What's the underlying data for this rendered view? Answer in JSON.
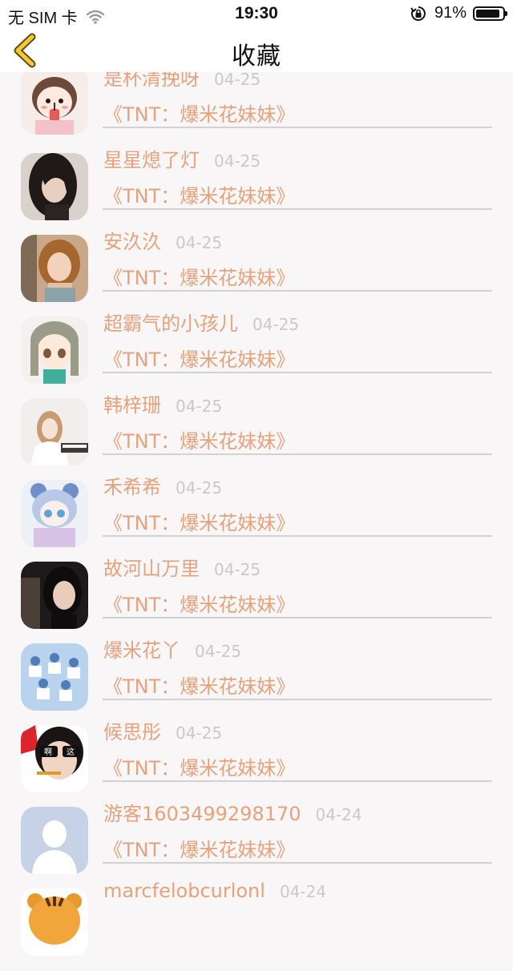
{
  "status_bar": {
    "carrier": "无 SIM 卡",
    "time": "19:30",
    "battery_percent": "91%",
    "battery_level": 0.91
  },
  "nav": {
    "title": "收藏",
    "back_icon": "chevron-left-icon"
  },
  "colors": {
    "accent": "#e6a27c",
    "date": "#c9c9c9",
    "back_arrow": "#f2c93a",
    "divider": "#d3d1d2",
    "background": "#f8f6f7"
  },
  "favorites": [
    {
      "name": "是杯清挽呀",
      "date": "04-25",
      "work": "《TNT：爆米花妹妹》",
      "avatar": "cartoon-girl-drink-avatar"
    },
    {
      "name": "星星熄了灯",
      "date": "04-25",
      "work": "《TNT：爆米花妹妹》",
      "avatar": "girl-dark-hair-avatar"
    },
    {
      "name": "安汣汣",
      "date": "04-25",
      "work": "《TNT：爆米花妹妹》",
      "avatar": "girl-portrait-avatar"
    },
    {
      "name": "超霸气的小孩儿",
      "date": "04-25",
      "work": "《TNT：爆米花妹妹》",
      "avatar": "anime-girl-avatar"
    },
    {
      "name": "韩梓珊",
      "date": "04-25",
      "work": "《TNT：爆米花妹妹》",
      "avatar": "girl-piano-avatar"
    },
    {
      "name": "禾希希",
      "date": "04-25",
      "work": "《TNT：爆米花妹妹》",
      "avatar": "anime-blue-bear-avatar"
    },
    {
      "name": "故河山万里",
      "date": "04-25",
      "work": "《TNT：爆米花妹妹》",
      "avatar": "girl-night-avatar"
    },
    {
      "name": "爆米花丫",
      "date": "04-25",
      "work": "《TNT：爆米花妹妹》",
      "avatar": "group-photo-avatar"
    },
    {
      "name": "候思彤",
      "date": "04-25",
      "work": "《TNT：爆米花妹妹》",
      "avatar": "girl-sunglasses-avatar",
      "avatar_text": [
        "啊",
        "这"
      ]
    },
    {
      "name": "游客1603499298170",
      "date": "04-24",
      "work": "《TNT：爆米花妹妹》",
      "avatar": "default-user-avatar"
    },
    {
      "name": "marcfelobcurlonl",
      "date": "04-24",
      "work": "",
      "avatar": "tiger-avatar"
    }
  ]
}
